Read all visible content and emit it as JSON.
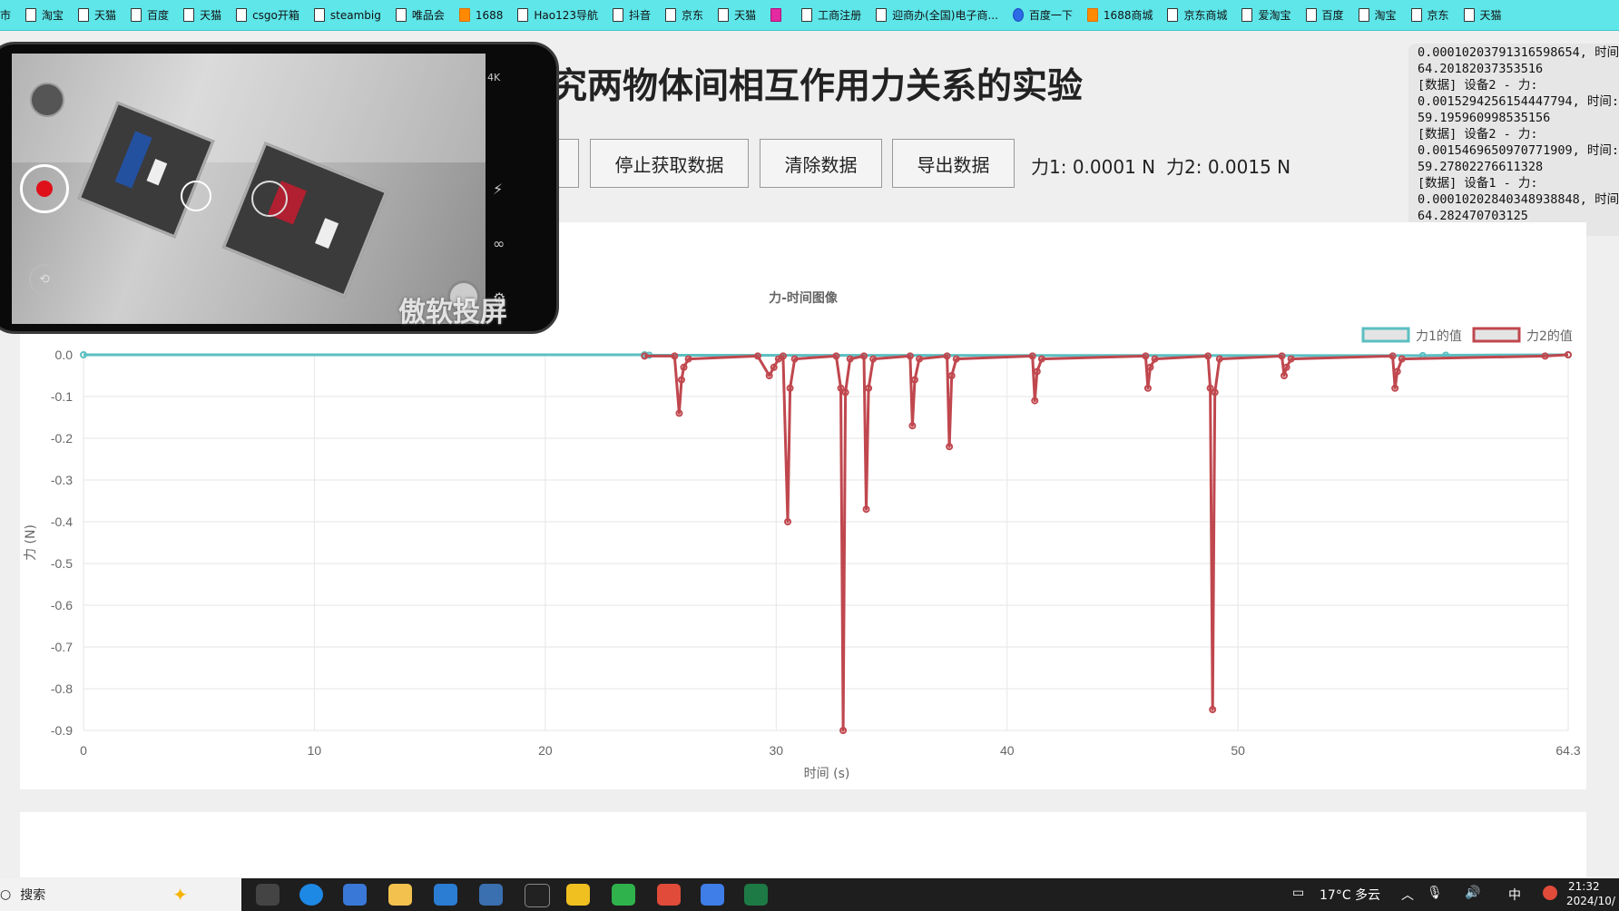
{
  "bookmarks": [
    "市",
    "淘宝",
    "天猫",
    "百度",
    "天猫",
    "csgo开箱",
    "steambig",
    "唯品会",
    "1688",
    "Hao123导航",
    "抖音",
    "京东",
    "天猫",
    "",
    "工商注册",
    "迎商办(全国)电子商...",
    "百度一下",
    "1688商城",
    "京东商城",
    "爱淘宝",
    "百度",
    "淘宝",
    "京东",
    "天猫"
  ],
  "page": {
    "title": "究两物体间相互作用力关系的实验",
    "buttons": {
      "stop": "停止获取数据",
      "clear": "清除数据",
      "export": "导出数据"
    },
    "force1_readout": "力1: 0.0001 N",
    "force2_readout": "力2: 0.0015 N"
  },
  "log_text": "0.00010203791316598654, 时间:\n64.20182037353516\n[数据] 设备2 - 力:\n0.0015294256154447794, 时间:\n59.195960998535156\n[数据] 设备2 - 力:\n0.0015469650970771909, 时间:\n59.27802276611328\n[数据] 设备1 - 力:\n0.00010202840348938848, 时间:\n64.282470703125",
  "phone": {
    "watermark": "傲软投屏"
  },
  "chart_data": {
    "type": "line",
    "title": "力-时间图像",
    "xlabel": "时间 (s)",
    "ylabel": "力 (N)",
    "xlim": [
      0,
      64.3
    ],
    "ylim": [
      -0.9,
      0.0
    ],
    "x_ticks": [
      "0",
      "10",
      "20",
      "30",
      "40",
      "50",
      "64.3"
    ],
    "y_ticks": [
      "0.0",
      "-0.1",
      "-0.2",
      "-0.3",
      "-0.4",
      "-0.5",
      "-0.6",
      "-0.7",
      "-0.8",
      "-0.9"
    ],
    "series": [
      {
        "name": "力1的值",
        "color": "#5bbfc2",
        "points": [
          [
            0,
            0
          ],
          [
            24.3,
            0
          ],
          [
            24.5,
            -0.001
          ],
          [
            58,
            -0.002
          ],
          [
            59,
            -0.001
          ],
          [
            64.3,
            0
          ]
        ]
      },
      {
        "name": "力2的值",
        "color": "#c0474e",
        "points": [
          [
            24.3,
            -0.003
          ],
          [
            25.6,
            -0.003
          ],
          [
            25.8,
            -0.14
          ],
          [
            25.9,
            -0.06
          ],
          [
            26.0,
            -0.03
          ],
          [
            26.2,
            -0.01
          ],
          [
            29.2,
            -0.003
          ],
          [
            29.7,
            -0.05
          ],
          [
            29.9,
            -0.03
          ],
          [
            30.1,
            -0.01
          ],
          [
            30.3,
            -0.003
          ],
          [
            30.5,
            -0.4
          ],
          [
            30.6,
            -0.08
          ],
          [
            30.8,
            -0.01
          ],
          [
            32.6,
            -0.003
          ],
          [
            32.8,
            -0.08
          ],
          [
            32.9,
            -0.9
          ],
          [
            33.0,
            -0.09
          ],
          [
            33.2,
            -0.01
          ],
          [
            33.8,
            -0.003
          ],
          [
            33.9,
            -0.37
          ],
          [
            34.0,
            -0.08
          ],
          [
            34.2,
            -0.01
          ],
          [
            35.8,
            -0.003
          ],
          [
            35.9,
            -0.17
          ],
          [
            36.0,
            -0.06
          ],
          [
            36.2,
            -0.01
          ],
          [
            37.4,
            -0.003
          ],
          [
            37.5,
            -0.22
          ],
          [
            37.6,
            -0.05
          ],
          [
            37.8,
            -0.01
          ],
          [
            41.1,
            -0.003
          ],
          [
            41.2,
            -0.11
          ],
          [
            41.3,
            -0.04
          ],
          [
            41.5,
            -0.01
          ],
          [
            46.0,
            -0.003
          ],
          [
            46.1,
            -0.08
          ],
          [
            46.2,
            -0.03
          ],
          [
            46.4,
            -0.01
          ],
          [
            48.7,
            -0.003
          ],
          [
            48.8,
            -0.08
          ],
          [
            48.9,
            -0.85
          ],
          [
            49.0,
            -0.09
          ],
          [
            49.2,
            -0.01
          ],
          [
            51.9,
            -0.003
          ],
          [
            52.0,
            -0.05
          ],
          [
            52.1,
            -0.03
          ],
          [
            52.3,
            -0.01
          ],
          [
            56.7,
            -0.003
          ],
          [
            56.8,
            -0.08
          ],
          [
            56.9,
            -0.04
          ],
          [
            57.1,
            -0.01
          ],
          [
            63.3,
            -0.003
          ],
          [
            64.3,
            0
          ]
        ]
      }
    ]
  },
  "taskbar": {
    "search": "搜索",
    "weather": "17°C 多云",
    "time": "21:32",
    "date": "2024/10/",
    "ime": "中"
  }
}
